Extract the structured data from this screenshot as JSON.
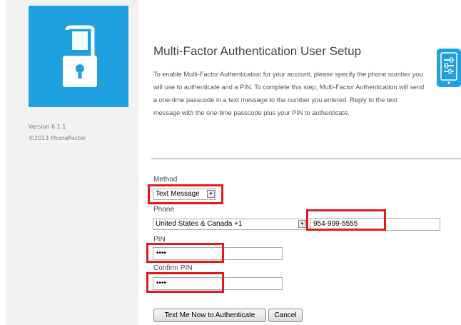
{
  "left_panel": {
    "version": "Version 6.1.1",
    "copyright": "©2013 PhoneFactor"
  },
  "main": {
    "title": "Multi-Factor Authentication User Setup",
    "intro": "To enable Multi-Factor Authentication for your account, please specify the phone number you will use to authenticate and a PIN. To complete this step, Multi-Factor Authentication will send a one-time passcode in a text message to the number you entered. Reply to the text message with the one-time passcode plus your PIN to authenticate."
  },
  "form": {
    "method_label": "Method",
    "method_value": "Text Message",
    "phone_label": "Phone",
    "country_value": "United States & Canada +1",
    "phone_value": "954-999-5555",
    "pin_label": "PIN",
    "pin_value": "••••",
    "confirm_pin_label": "Confirm PIN",
    "confirm_pin_value": "••••"
  },
  "buttons": {
    "authenticate_label": "Text Me Now to Authenticate",
    "cancel_label": "Cancel"
  },
  "colors": {
    "brand_blue": "#21a0e0",
    "highlight_red": "#e4191c"
  },
  "icons": {
    "logo": "phone-padlock-icon",
    "setup": "phone-settings-icon"
  }
}
